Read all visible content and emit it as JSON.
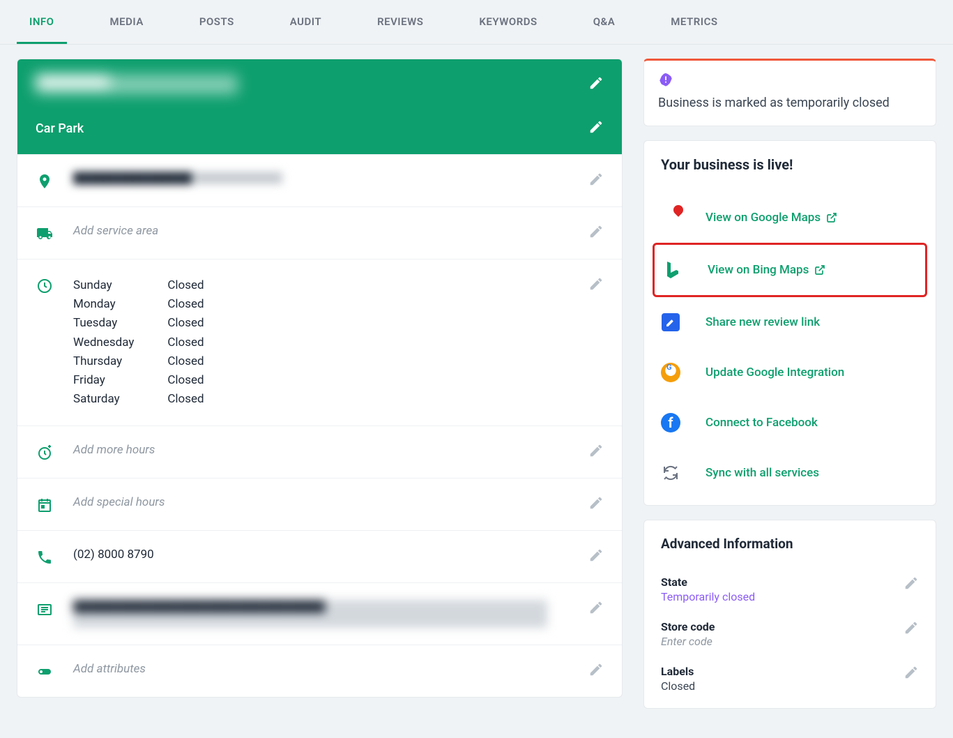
{
  "tabs": {
    "info": "INFO",
    "media": "MEDIA",
    "posts": "POSTS",
    "audit": "AUDIT",
    "reviews": "REVIEWS",
    "keywords": "KEYWORDS",
    "qa": "Q&A",
    "metrics": "METRICS"
  },
  "header": {
    "business_name": "██████████",
    "category": "Car Park"
  },
  "info": {
    "address": "████████████████",
    "service_area_placeholder": "Add service area",
    "hours": {
      "days": [
        "Sunday",
        "Monday",
        "Tuesday",
        "Wednesday",
        "Thursday",
        "Friday",
        "Saturday"
      ],
      "status": [
        "Closed",
        "Closed",
        "Closed",
        "Closed",
        "Closed",
        "Closed",
        "Closed"
      ]
    },
    "more_hours_placeholder": "Add more hours",
    "special_hours_placeholder": "Add special hours",
    "phone": "(02) 8000 8790",
    "description": "██████████████████████████████████",
    "attributes_placeholder": "Add attributes"
  },
  "alert": {
    "text": "Business is marked as temporarily closed"
  },
  "live": {
    "title": "Your business is live!",
    "google_maps": "View on Google Maps",
    "bing_maps": "View on Bing Maps",
    "review_link": "Share new review link",
    "google_integration": "Update Google Integration",
    "facebook": "Connect to Facebook",
    "sync": "Sync with all services"
  },
  "advanced": {
    "title": "Advanced Information",
    "state_label": "State",
    "state_value": "Temporarily closed",
    "store_code_label": "Store code",
    "store_code_placeholder": "Enter code",
    "labels_label": "Labels",
    "labels_value": "Closed"
  }
}
